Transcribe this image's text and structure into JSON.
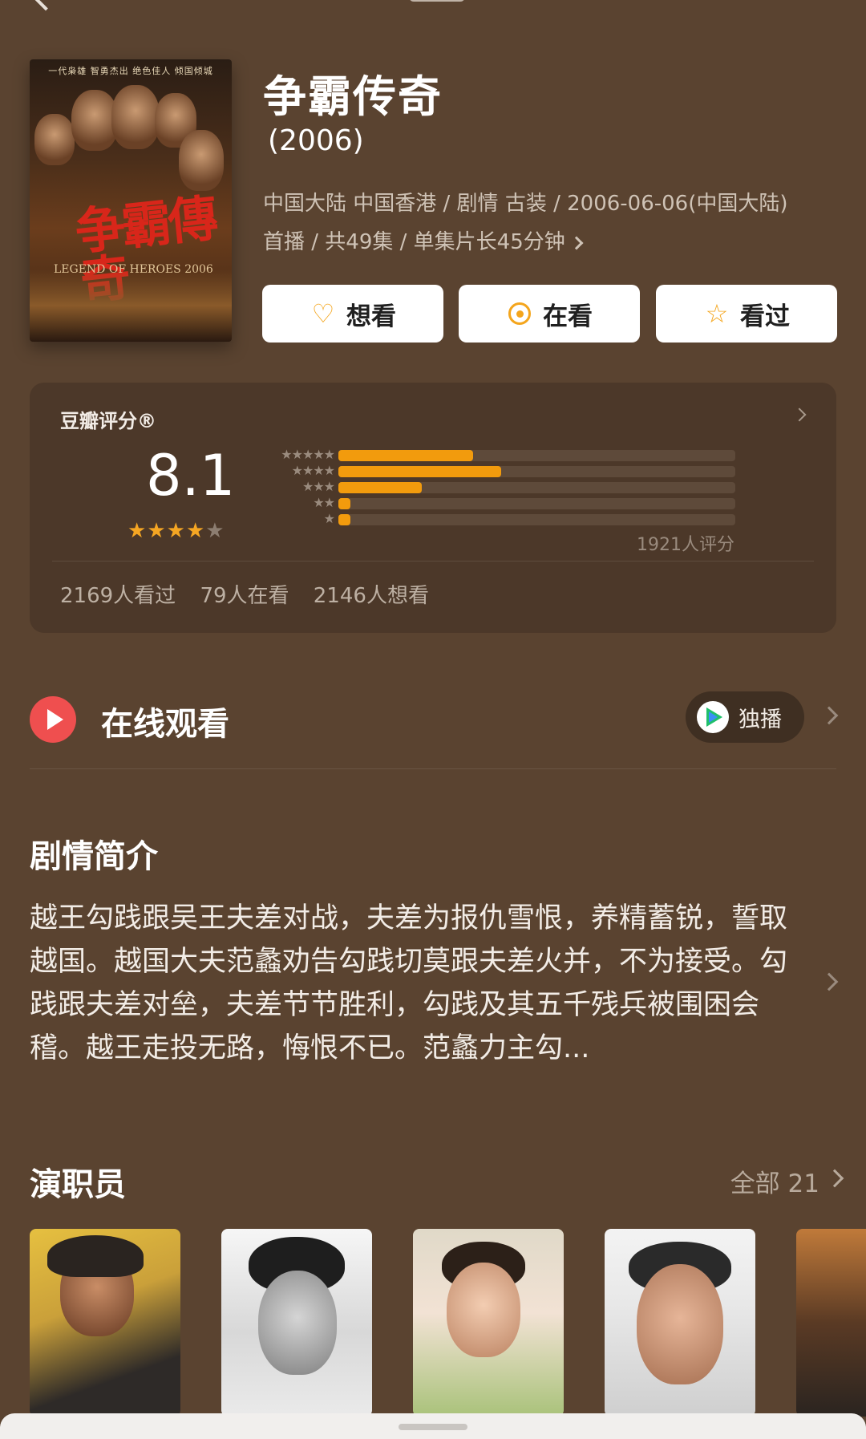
{
  "movie": {
    "title": "争霸传奇",
    "year": "(2006)",
    "meta_line1": "中国大陆 中国香港 / 剧情 古装 / 2006-06-06(中国大陆)",
    "meta_line2": "首播 / 共49集 / 单集片长45分钟",
    "poster": {
      "tagline": "一代枭雄 智勇杰出 绝色佳人 倾国倾城",
      "title_art": "争霸傳奇",
      "english_art": "LEGEND OF HEROES 2006"
    }
  },
  "actions": {
    "want": "想看",
    "watching": "在看",
    "watched": "看过"
  },
  "rating": {
    "label": "豆瓣评分®",
    "score": "8.1",
    "stars_filled": 4,
    "stars_total": 5,
    "distribution": [
      {
        "stars": 5,
        "fraction": 0.34
      },
      {
        "stars": 4,
        "fraction": 0.41
      },
      {
        "stars": 3,
        "fraction": 0.21
      },
      {
        "stars": 2,
        "fraction": 0.03
      },
      {
        "stars": 1,
        "fraction": 0.03
      }
    ],
    "count_text": "1921人评分",
    "stats": {
      "watched": "2169人看过",
      "watching": "79人在看",
      "want": "2146人想看"
    }
  },
  "online": {
    "title": "在线观看",
    "badge": "独播",
    "platform_icon": "tencent-video-icon"
  },
  "synopsis": {
    "title": "剧情简介",
    "text": "越王勾践跟吴王夫差对战，夫差为报仇雪恨，养精蓄锐，誓取越国。越国大夫范蠡劝告勾践切莫跟夫差火并，不为接受。勾践跟夫差对垒，夫差节节胜利，勾践及其五千残兵被围困会稽。越王走投无路，悔恨不已。范蠡力主勾..."
  },
  "cast": {
    "title": "演职员",
    "all_label": "全部 21"
  },
  "colors": {
    "background": "#5a4330",
    "card": "#4c3829",
    "accent": "#f29b0d",
    "play": "#ef4f4f"
  }
}
